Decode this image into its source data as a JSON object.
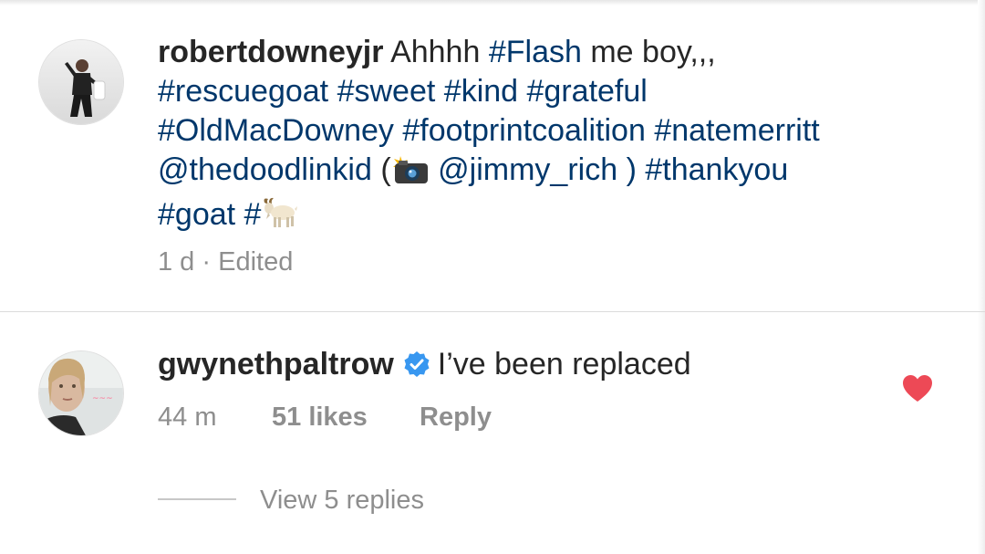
{
  "post": {
    "username": "robertdowneyjr",
    "text_before": "Ahhhh",
    "tag_flash": "#Flash",
    "text_after": "me boy,,,",
    "line2": [
      "#rescuegoat",
      "#sweet",
      "#kind",
      "#grateful"
    ],
    "line3": [
      "#OldMacDowney",
      "#footprintcoalition",
      "#natemerritt"
    ],
    "mention_doodle": "@thedoodlinkid",
    "paren_open": "(",
    "mention_jimmy": "@jimmy_rich",
    "paren_close": ")",
    "tag_thankyou": "#thankyou",
    "tag_goat": "#goat",
    "tag_hash": "#",
    "time": "1 d",
    "separator": "·",
    "edited": "Edited",
    "icons": [
      "camera-flash-emoji",
      "goat-emoji"
    ]
  },
  "comment": {
    "username": "gwynethpaltrow",
    "text": "I’ve been replaced",
    "time": "44 m",
    "likes": "51 likes",
    "reply": "Reply",
    "view_replies": "View 5 replies",
    "icons": [
      "verified-badge-icon",
      "heart-icon"
    ]
  },
  "colors": {
    "text": "#262626",
    "hashtag": "#00376b",
    "meta": "#8e8e8e",
    "verified": "#3897f0",
    "heart": "#ed4956"
  }
}
